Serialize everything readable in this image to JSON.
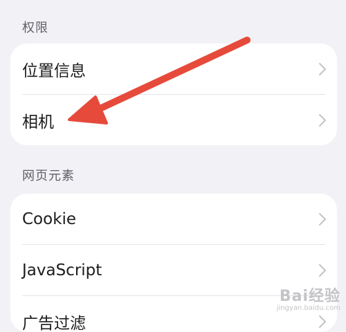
{
  "sections": [
    {
      "header": "权限",
      "items": [
        {
          "label": "位置信息"
        },
        {
          "label": "相机"
        }
      ]
    },
    {
      "header": "网页元素",
      "items": [
        {
          "label": "Cookie"
        },
        {
          "label": "JavaScript"
        },
        {
          "label": "广告过滤"
        }
      ]
    }
  ],
  "chevron_icon": "chevron-right-icon",
  "annotation": {
    "color": "#e64a3b",
    "target": "相机"
  },
  "watermark": {
    "brand": "Bai经验",
    "url": "jingyan.baidu.com"
  }
}
